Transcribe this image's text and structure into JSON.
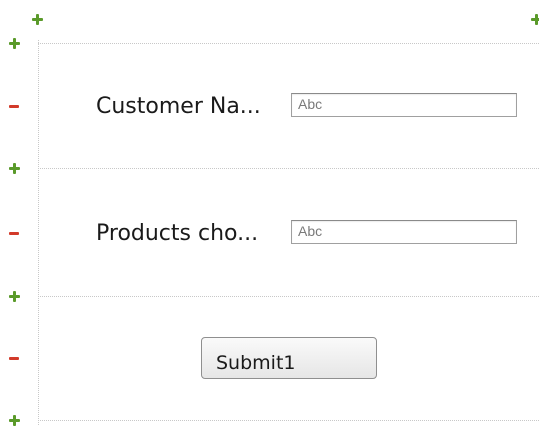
{
  "form": {
    "fields": [
      {
        "label": "Customer Na...",
        "placeholder": "Abc"
      },
      {
        "label": "Products cho...",
        "placeholder": "Abc"
      }
    ],
    "submit_label": "Submit1"
  },
  "icons": {
    "add_row": "plus-icon",
    "remove_row": "minus-icon"
  },
  "colors": {
    "add_icon": "#5a9a2a",
    "remove_icon": "#d23a2a",
    "grid_dots": "#c8c8c8"
  }
}
